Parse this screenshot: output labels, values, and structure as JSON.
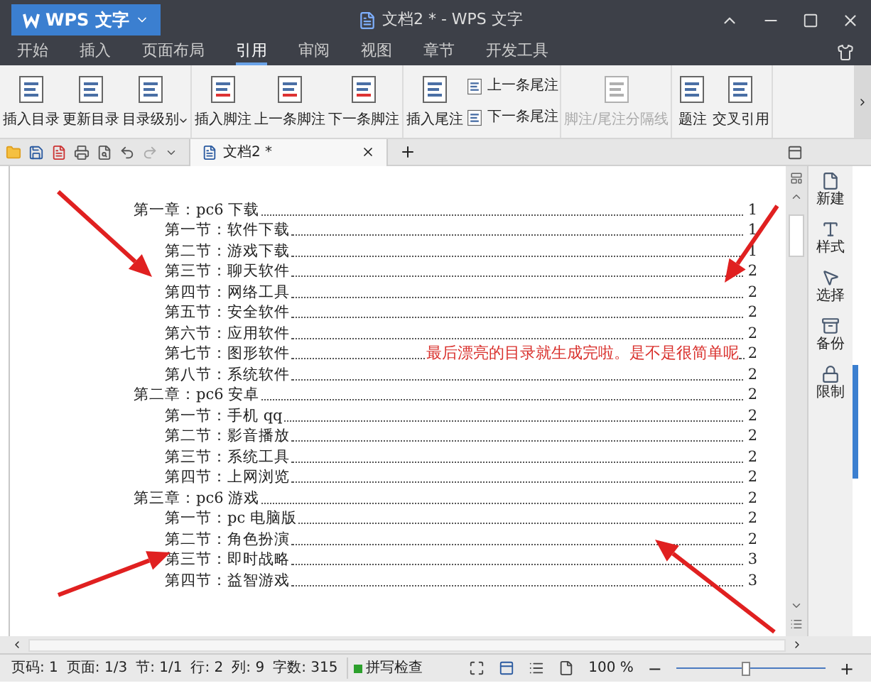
{
  "window": {
    "app_button": "WPS 文字",
    "title": "文档2 * - WPS 文字"
  },
  "menu_tabs": [
    {
      "label": "开始",
      "selected": false
    },
    {
      "label": "插入",
      "selected": false
    },
    {
      "label": "页面布局",
      "selected": false
    },
    {
      "label": "引用",
      "selected": true
    },
    {
      "label": "审阅",
      "selected": false
    },
    {
      "label": "视图",
      "selected": false
    },
    {
      "label": "章节",
      "selected": false
    },
    {
      "label": "开发工具",
      "selected": false
    }
  ],
  "ribbon": [
    {
      "items": [
        {
          "kind": "large",
          "label": "插入目录",
          "disabled": false
        },
        {
          "kind": "large",
          "label": "更新目录",
          "disabled": false
        },
        {
          "kind": "dropdown",
          "label": "目录级别",
          "disabled": false
        }
      ]
    },
    {
      "items": [
        {
          "kind": "large",
          "label": "插入脚注",
          "disabled": false
        },
        {
          "kind": "large",
          "label": "上一条脚注",
          "disabled": false
        },
        {
          "kind": "large",
          "label": "下一条脚注",
          "disabled": false
        }
      ]
    },
    {
      "items": [
        {
          "kind": "large",
          "label": "插入尾注",
          "disabled": false
        },
        {
          "kind": "small",
          "label": "上一条尾注",
          "disabled": false
        },
        {
          "kind": "small",
          "label": "下一条尾注",
          "disabled": false
        }
      ]
    },
    {
      "items": [
        {
          "kind": "large",
          "label": "脚注/尾注分隔线",
          "disabled": true
        }
      ]
    },
    {
      "items": [
        {
          "kind": "large",
          "label": "题注",
          "disabled": false
        },
        {
          "kind": "large",
          "label": "交叉引用",
          "disabled": false
        }
      ]
    }
  ],
  "doc_tabs": [
    {
      "label": "文档2 *",
      "selected": true
    }
  ],
  "toc": [
    {
      "title": "第一章：pc6 下载",
      "page": "1",
      "children": [
        {
          "title": "第一节：软件下载",
          "page": "1"
        },
        {
          "title": "第二节：游戏下载",
          "page": "1"
        },
        {
          "title": "第三节：聊天软件",
          "page": "2"
        },
        {
          "title": "第四节：网络工具",
          "page": "2"
        },
        {
          "title": "第五节：安全软件",
          "page": "2"
        },
        {
          "title": "第六节：应用软件",
          "page": "2"
        },
        {
          "title": "第七节：图形软件",
          "page": "2",
          "note": "最后漂亮的目录就生成完啦。是不是很简单呢"
        },
        {
          "title": "第八节：系统软件",
          "page": "2"
        }
      ]
    },
    {
      "title": "第二章：pc6 安卓",
      "page": "2",
      "children": [
        {
          "title": "第一节：手机 qq",
          "page": "2"
        },
        {
          "title": "第二节：影音播放",
          "page": "2"
        },
        {
          "title": "第三节：系统工具",
          "page": "2"
        },
        {
          "title": "第四节：上网浏览",
          "page": "2"
        }
      ]
    },
    {
      "title": "第三章：pc6 游戏",
      "page": "2",
      "children": [
        {
          "title": "第一节：pc 电脑版",
          "page": "2"
        },
        {
          "title": "第二节：角色扮演",
          "page": "2"
        },
        {
          "title": "第三节：即时战略",
          "page": "3"
        },
        {
          "title": "第四节：益智游戏",
          "page": "3"
        }
      ]
    }
  ],
  "side_panel": [
    "新建",
    "样式",
    "选择",
    "备份",
    "限制"
  ],
  "status_bar": {
    "items": [
      "页码: 1",
      "页面: 1/3",
      "节: 1/1",
      "行: 2",
      "列: 9",
      "字数: 315"
    ],
    "spell_check": {
      "label": "拼写检查",
      "on": true
    },
    "zoom": "100 %",
    "zoom_out": "−",
    "zoom_in": "+",
    "zoom_slider": {
      "level": 0.47
    }
  }
}
